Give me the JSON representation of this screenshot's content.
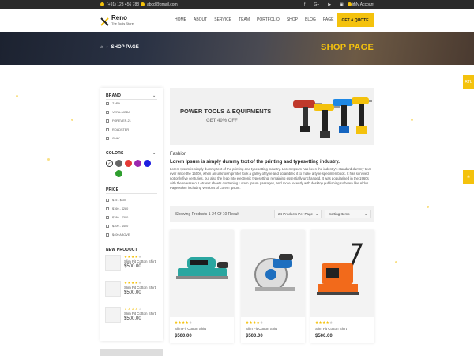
{
  "topbar": {
    "phone": "(+91) 123 456 788",
    "email": "abcd@gmail.com",
    "social": [
      "f",
      "G+",
      "▶",
      "▣",
      "in"
    ],
    "account": "My Account"
  },
  "logo": {
    "name": "Reno",
    "tagline": "The Tools Store"
  },
  "nav": [
    "HOME",
    "ABOUT",
    "SERVICE",
    "TEAM",
    "PORTFOLIO",
    "SHOP",
    "BLOG",
    "PAGE"
  ],
  "quote_button": "GET A QUOTE",
  "hero": {
    "breadcrumb": "SHOP PAGE",
    "title": "SHOP PAGE"
  },
  "side_tabs": {
    "rtl": "RTL"
  },
  "sidebar": {
    "brand": {
      "title": "BRAND",
      "items": [
        "ZARA",
        "VERA-MODA",
        "FOREVER-21",
        "ROADSTER",
        "ONLY"
      ]
    },
    "colors": {
      "title": "COLORS",
      "swatches": [
        "#ffffff",
        "#666666",
        "#e53935",
        "#9c27b0",
        "#1e1ee0",
        "#2e9e2e"
      ]
    },
    "price": {
      "title": "PRICE",
      "items": [
        "$15 - $100",
        "$160 - $280",
        "$280 - $300",
        "$300 - $400",
        "$400 ABOVE"
      ]
    },
    "new_product": {
      "title": "NEW PRODUCT",
      "items": [
        {
          "name": "Slim Fit Cotton Shirt",
          "price": "$500.00",
          "rating": 4
        },
        {
          "name": "Slim Fit Cotton Shirt",
          "price": "$500.00",
          "rating": 4
        },
        {
          "name": "Slim Fit Cotton Shirt",
          "price": "$500.00",
          "rating": 4
        }
      ]
    }
  },
  "banner": {
    "title": "POWER TOOLS & EQUIPMENTS",
    "offer": "GET 40% OFF"
  },
  "description": {
    "heading": "Fashion",
    "subheading": "Lorem Ipsum is simply dummy text of the printing and typesetting industry.",
    "body": "Lorem Ipsum is simply dummy text of the printing and typesetting industry. Lorem Ipsum has been the industry's standard dummy text ever since the 1500s, when an unknown printer took a galley of type and scrambled it to make a type specimen book. It has survived not only five centuries, but also the leap into electronic typesetting, remaining essentially unchanged. It was popularised in the 1960s with the release of Letraset sheets containing Lorem Ipsum passages, and more recently with desktop publishing software like Aldus PageMaker including versions of Lorem Ipsum."
  },
  "toolbar": {
    "result": "Showing Products 1-24 Of 10 Result",
    "per_page": "24 Products Per Page",
    "sorting": "Sorting Items"
  },
  "products": [
    {
      "name": "Slim Fit Cotton Shirt",
      "price": "$500.00",
      "rating": 4
    },
    {
      "name": "Slim Fit Cotton Shirt",
      "price": "$500.00",
      "rating": 4
    },
    {
      "name": "Slim Fit Cotton Shirt",
      "price": "$500.00",
      "rating": 4
    }
  ],
  "colors": {
    "accent": "#f4c20d",
    "dark": "#2b2b2b"
  }
}
